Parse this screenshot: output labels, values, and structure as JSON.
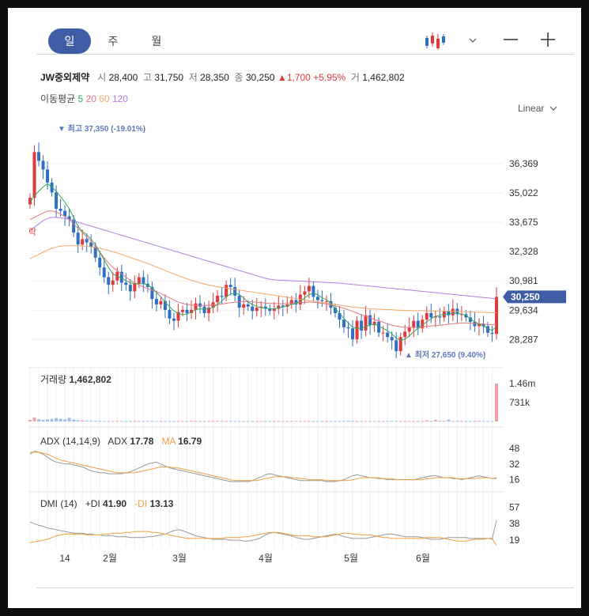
{
  "tabs": [
    "일",
    "주",
    "월"
  ],
  "stock": {
    "name": "JW중외제약",
    "open_label": "시",
    "open": "28,400",
    "high_label": "고",
    "high": "31,750",
    "low_label": "저",
    "low": "28,350",
    "close_label": "종",
    "close": "30,250",
    "change": "1,700",
    "change_pct": "+5.95%",
    "volume_label": "거",
    "volume": "1,462,802"
  },
  "ma": {
    "label": "이동평균",
    "p5": "5",
    "p20": "20",
    "p60": "60",
    "p120": "120"
  },
  "scale_label": "Linear",
  "colors": {
    "up": "#e0393e",
    "down": "#2f6fc4",
    "ma5": "#35a85a",
    "ma20": "#e8797f",
    "ma60": "#f0a868",
    "ma120": "#b07fe0",
    "accent": "#3f5da4",
    "adx": "#999999",
    "dmi_minus": "#f0a040"
  },
  "chart_data": [
    {
      "type": "candlestick",
      "y_ticks": [
        "36,369",
        "35,022",
        "33,675",
        "32,328",
        "30,981",
        "29,634",
        "28,287"
      ],
      "ylim": [
        27100,
        38150
      ],
      "x_ticks": [
        "14",
        "2월",
        "3월",
        "4월",
        "5월",
        "6월"
      ],
      "current_price": "30,250",
      "max_label": "최고 37,350 (-19.01%)",
      "min_label": "최저 27,650 (9.40%)",
      "left_edge_label": "락",
      "closes": [
        34800,
        36900,
        36500,
        36100,
        35500,
        35050,
        34300,
        34200,
        33950,
        33800,
        33200,
        32650,
        32900,
        32750,
        32550,
        32050,
        31600,
        31150,
        30800,
        31000,
        31400,
        30900,
        30800,
        30500,
        30850,
        31150,
        30850,
        30700,
        30150,
        29900,
        30050,
        29650,
        29250,
        29150,
        29550,
        29650,
        29500,
        29650,
        29950,
        29800,
        29500,
        29750,
        30000,
        30300,
        30250,
        30800,
        30700,
        30300,
        29750,
        29900,
        29800,
        29600,
        29750,
        29800,
        29700,
        29600,
        29700,
        29850,
        29800,
        29900,
        30100,
        29900,
        30350,
        30500,
        30750,
        30250,
        30100,
        30050,
        30050,
        29750,
        29500,
        29200,
        28850,
        28800,
        28300,
        29150,
        28700,
        29400,
        28950,
        29100,
        28600,
        28600,
        28400,
        28250,
        27750,
        28400,
        28650,
        28850,
        29150,
        28800,
        29200,
        29500,
        29300,
        29350,
        29300,
        29600,
        29400,
        29700,
        29450,
        29450,
        29300,
        29100,
        28900,
        29000,
        28900,
        28600,
        28550,
        30250
      ],
      "ma5": [
        34600,
        34900,
        35100,
        35300,
        35450,
        35300,
        35100,
        34850,
        34600,
        34300,
        33900,
        33500,
        33250,
        33100,
        32900,
        32650,
        32300,
        31950,
        31600,
        31300,
        31200,
        31100,
        31000,
        30900,
        30850,
        30850,
        30850,
        30800,
        30650,
        30450,
        30250,
        30000,
        29800,
        29600,
        29480,
        29430,
        29450,
        29550,
        29650,
        29700,
        29680,
        29700,
        29780,
        29900,
        30050,
        30250,
        30380,
        30420,
        30350,
        30200,
        30000,
        29900,
        29800,
        29750,
        29720,
        29700,
        29700,
        29740,
        29780,
        29820,
        29900,
        29950,
        30050,
        30200,
        30350,
        30420,
        30350,
        30200,
        30120,
        29950,
        29700,
        29500,
        29250,
        29050,
        28850,
        28800,
        28800,
        28880,
        28950,
        29000,
        28900,
        28800,
        28700,
        28550,
        28350,
        28250,
        28300,
        28450,
        28650,
        28800,
        28950,
        29100,
        29250,
        29350,
        29400,
        29450,
        29450,
        29500,
        29500,
        29450,
        29400,
        29250,
        29100,
        29000,
        28900,
        28800,
        28700,
        28900
      ],
      "ma20": [
        33800,
        33900,
        34000,
        34100,
        34200,
        34200,
        34150,
        34050,
        33950,
        33800,
        33600,
        33400,
        33200,
        33000,
        32800,
        32550,
        32300,
        32050,
        31800,
        31600,
        31450,
        31300,
        31150,
        31000,
        30900,
        30800,
        30700,
        30620,
        30550,
        30480,
        30400,
        30300,
        30200,
        30100,
        30000,
        29950,
        29900,
        29870,
        29850,
        29850,
        29850,
        29860,
        29870,
        29890,
        29920,
        29950,
        29980,
        30000,
        30020,
        30030,
        30030,
        30020,
        30000,
        29980,
        29960,
        29950,
        29940,
        29930,
        29930,
        29940,
        29950,
        29970,
        29990,
        30000,
        30010,
        30000,
        29980,
        29950,
        29920,
        29880,
        29830,
        29780,
        29720,
        29650,
        29580,
        29500,
        29420,
        29350,
        29280,
        29210,
        29150,
        29080,
        29000,
        28950,
        28900,
        28870,
        28850,
        28840,
        28840,
        28850,
        28870,
        28890,
        28910,
        28930,
        28950,
        28970,
        28990,
        29010,
        29030,
        29040,
        29050,
        29040,
        29030,
        29020,
        29000,
        28980,
        28960,
        29000
      ],
      "ma60": [
        32000,
        32100,
        32200,
        32300,
        32400,
        32480,
        32540,
        32580,
        32600,
        32600,
        32600,
        32600,
        32590,
        32570,
        32550,
        32520,
        32480,
        32430,
        32380,
        32320,
        32260,
        32200,
        32130,
        32060,
        31990,
        31920,
        31850,
        31780,
        31700,
        31620,
        31540,
        31460,
        31380,
        31300,
        31220,
        31150,
        31080,
        31010,
        30950,
        30890,
        30840,
        30790,
        30750,
        30710,
        30680,
        30650,
        30620,
        30590,
        30560,
        30530,
        30500,
        30470,
        30440,
        30410,
        30380,
        30350,
        30320,
        30290,
        30260,
        30230,
        30200,
        30170,
        30140,
        30110,
        30080,
        30050,
        30020,
        29990,
        29960,
        29930,
        29900,
        29870,
        29840,
        29810,
        29780,
        29760,
        29740,
        29720,
        29700,
        29690,
        29680,
        29670,
        29660,
        29650,
        29640,
        29630,
        29620,
        29620,
        29610,
        29610,
        29610,
        29600,
        29600,
        29600,
        29590,
        29590,
        29590,
        29580,
        29580,
        29570,
        29560,
        29560,
        29550,
        29540,
        29540,
        29530,
        29520,
        29520
      ],
      "ma120": [
        33300,
        33450,
        33600,
        33750,
        33850,
        33900,
        33900,
        33880,
        33850,
        33800,
        33740,
        33680,
        33620,
        33560,
        33500,
        33440,
        33380,
        33320,
        33260,
        33200,
        33140,
        33080,
        33020,
        32960,
        32900,
        32840,
        32780,
        32720,
        32660,
        32600,
        32540,
        32480,
        32420,
        32360,
        32300,
        32240,
        32180,
        32120,
        32060,
        32000,
        31940,
        31880,
        31820,
        31760,
        31700,
        31640,
        31580,
        31520,
        31460,
        31400,
        31340,
        31280,
        31220,
        31160,
        31100,
        31060,
        31030,
        31020,
        31010,
        31000,
        30990,
        30980,
        30970,
        30960,
        30950,
        30940,
        30930,
        30920,
        30910,
        30900,
        30890,
        30880,
        30860,
        30840,
        30820,
        30800,
        30780,
        30760,
        30740,
        30720,
        30700,
        30680,
        30660,
        30640,
        30620,
        30600,
        30580,
        30560,
        30540,
        30520,
        30500,
        30480,
        30460,
        30440,
        30420,
        30400,
        30380,
        30360,
        30340,
        30320,
        30300,
        30280,
        30260,
        30240,
        30220,
        30200,
        30180,
        30150
      ]
    },
    {
      "type": "bar",
      "title": "거래량",
      "latest": "1,462,802",
      "y_ticks": [
        "1.46m",
        "731k"
      ],
      "ylim": [
        0,
        1620000
      ],
      "values": [
        60000,
        150000,
        90000,
        60000,
        80000,
        100000,
        130000,
        100000,
        80000,
        140000,
        70000,
        50000,
        40000,
        30000,
        25000,
        20000,
        20000,
        20000,
        15000,
        20000,
        20000,
        20000,
        15000,
        20000,
        15000,
        15000,
        20000,
        20000,
        20000,
        15000,
        15000,
        20000,
        15000,
        15000,
        20000,
        15000,
        15000,
        20000,
        20000,
        15000,
        15000,
        15000,
        20000,
        25000,
        20000,
        15000,
        20000,
        20000,
        15000,
        15000,
        15000,
        20000,
        15000,
        15000,
        15000,
        20000,
        15000,
        20000,
        15000,
        15000,
        20000,
        20000,
        20000,
        15000,
        20000,
        15000,
        20000,
        15000,
        15000,
        20000,
        15000,
        20000,
        20000,
        20000,
        20000,
        15000,
        20000,
        15000,
        20000,
        15000,
        15000,
        15000,
        20000,
        20000,
        20000,
        20000,
        15000,
        20000,
        15000,
        20000,
        15000,
        40000,
        20000,
        60000,
        30000,
        20000,
        70000,
        15000,
        20000,
        20000,
        15000,
        15000,
        20000,
        20000,
        20000,
        15000,
        15000,
        1462802
      ]
    },
    {
      "type": "line",
      "title": "ADX (14,14,9)",
      "series_labels": {
        "adx": "ADX",
        "ma": "MA"
      },
      "latest": {
        "adx": "17.78",
        "ma": "16.79"
      },
      "y_ticks": [
        "48",
        "32",
        "16"
      ],
      "ylim": [
        10,
        52
      ],
      "adx": [
        42,
        45,
        44,
        42,
        39,
        36,
        34,
        33,
        32,
        32,
        31,
        30,
        29,
        27,
        25,
        24,
        23,
        23,
        22,
        22,
        22,
        22,
        23,
        24,
        26,
        28,
        30,
        32,
        33,
        34,
        32,
        30,
        28,
        27,
        26,
        25,
        24,
        23,
        22,
        21,
        20,
        19,
        18,
        17,
        16,
        15,
        14,
        14,
        14,
        14,
        14,
        15,
        17,
        19,
        21,
        22,
        21,
        20,
        19,
        18,
        17,
        16,
        15,
        15,
        15,
        15,
        15,
        15,
        14,
        14,
        14,
        15,
        16,
        18,
        20,
        21,
        20,
        19,
        18,
        18,
        17,
        17,
        16,
        16,
        16,
        16,
        16,
        16,
        16,
        17,
        18,
        19,
        20,
        20,
        19,
        18,
        18,
        17,
        17,
        16,
        17,
        18,
        19,
        20,
        19,
        18,
        17,
        18
      ],
      "ma": [
        44,
        44,
        44,
        43,
        42,
        40,
        38,
        36,
        35,
        34,
        33,
        32,
        31,
        30,
        29,
        28,
        27,
        26,
        25,
        24,
        23,
        23,
        23,
        23,
        23,
        24,
        25,
        26,
        27,
        28,
        29,
        29,
        29,
        28,
        28,
        27,
        26,
        25,
        24,
        23,
        22,
        21,
        20,
        19,
        18,
        17,
        16,
        15,
        15,
        15,
        15,
        15,
        15,
        16,
        17,
        18,
        19,
        19,
        19,
        19,
        18,
        18,
        17,
        17,
        16,
        16,
        16,
        16,
        15,
        15,
        15,
        15,
        15,
        15,
        16,
        17,
        18,
        18,
        18,
        18,
        18,
        17,
        17,
        17,
        16,
        16,
        16,
        16,
        16,
        16,
        16,
        17,
        17,
        18,
        18,
        18,
        18,
        18,
        17,
        17,
        17,
        17,
        17,
        18,
        18,
        18,
        17,
        17
      ]
    },
    {
      "type": "line",
      "title": "DMI (14)",
      "series_labels": {
        "plus": "+DI",
        "minus": "-DI"
      },
      "latest": {
        "plus": "41.90",
        "minus": "13.13"
      },
      "y_ticks": [
        "57",
        "38",
        "19"
      ],
      "ylim": [
        10,
        60
      ],
      "plus": [
        40,
        38,
        36,
        35,
        33,
        32,
        31,
        30,
        29,
        28,
        27,
        27,
        27,
        26,
        26,
        25,
        25,
        24,
        24,
        24,
        23,
        23,
        23,
        22,
        22,
        22,
        22,
        23,
        23,
        24,
        25,
        26,
        28,
        30,
        31,
        30,
        28,
        26,
        24,
        23,
        22,
        21,
        20,
        20,
        20,
        20,
        19,
        19,
        19,
        18,
        18,
        19,
        20,
        22,
        25,
        27,
        28,
        27,
        26,
        25,
        24,
        22,
        21,
        20,
        20,
        21,
        22,
        23,
        24,
        25,
        26,
        25,
        23,
        22,
        21,
        21,
        21,
        21,
        22,
        23,
        24,
        25,
        26,
        26,
        25,
        24,
        23,
        23,
        23,
        23,
        22,
        21,
        20,
        20,
        20,
        21,
        22,
        22,
        22,
        22,
        22,
        21,
        21,
        21,
        21,
        21,
        20,
        42
      ],
      "minus": [
        16,
        17,
        18,
        19,
        20,
        22,
        24,
        25,
        26,
        26,
        26,
        26,
        26,
        25,
        25,
        25,
        25,
        26,
        26,
        27,
        27,
        27,
        28,
        28,
        29,
        29,
        29,
        29,
        28,
        28,
        27,
        26,
        25,
        24,
        23,
        22,
        21,
        21,
        21,
        21,
        21,
        21,
        21,
        21,
        21,
        22,
        22,
        22,
        22,
        23,
        23,
        24,
        25,
        26,
        27,
        28,
        28,
        28,
        27,
        26,
        25,
        24,
        24,
        24,
        24,
        23,
        23,
        23,
        23,
        24,
        25,
        26,
        27,
        27,
        26,
        26,
        25,
        25,
        25,
        24,
        23,
        22,
        22,
        21,
        21,
        21,
        21,
        21,
        21,
        21,
        21,
        22,
        22,
        22,
        22,
        21,
        20,
        19,
        18,
        18,
        18,
        19,
        20,
        20,
        20,
        21,
        21,
        13
      ]
    }
  ]
}
